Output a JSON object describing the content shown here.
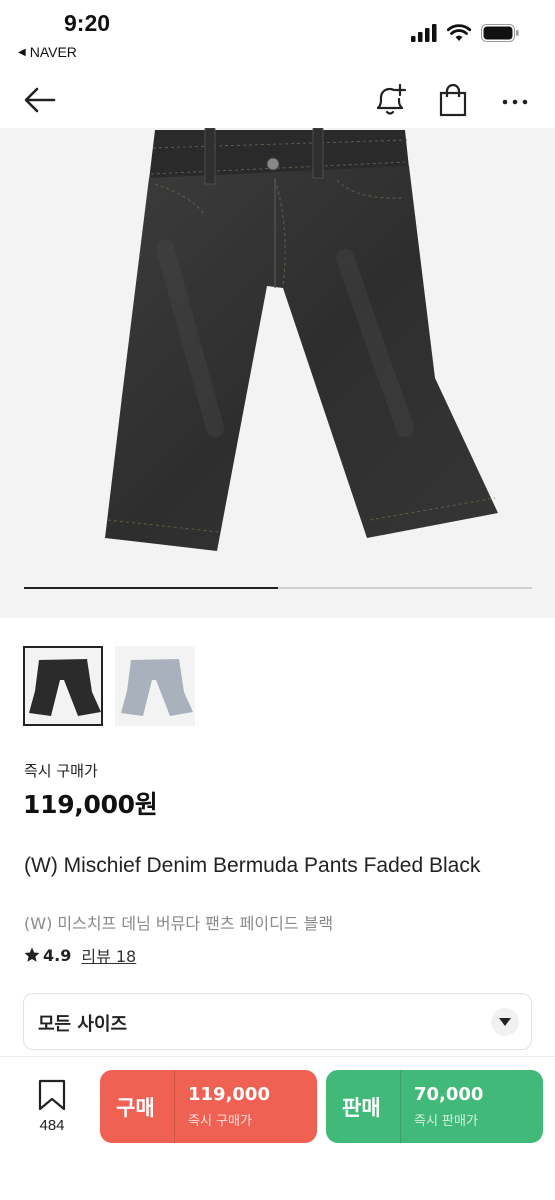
{
  "status_bar": {
    "time": "9:20",
    "back_app": "NAVER"
  },
  "product": {
    "price_label": "즉시 구매가",
    "price": "119,000원",
    "title_en": "(W) Mischief Denim Bermuda Pants Faded Black",
    "title_ko": "(W) 미스치프 데님 버뮤다 팬츠 페이디드 블랙",
    "rating": "4.9",
    "review_link": "리뷰 18",
    "image_progress": 0.5,
    "thumbnails": [
      {
        "name": "black-denim-shorts",
        "color": "#2b2b2b",
        "selected": true
      },
      {
        "name": "light-wash-denim-shorts",
        "color": "#a9b2bc",
        "selected": false
      }
    ]
  },
  "size_select": {
    "label": "모든 사이즈"
  },
  "bottom_bar": {
    "bookmark_count": "484",
    "buy": {
      "label": "구매",
      "price": "119,000",
      "sub": "즉시 구매가",
      "color": "#ef6253"
    },
    "sell": {
      "label": "판매",
      "price": "70,000",
      "sub": "즉시 판매가",
      "color": "#41b979"
    }
  },
  "icons": {
    "back": "arrow-left-icon",
    "alert": "bell-plus-icon",
    "bag": "shopping-bag-icon",
    "more": "ellipsis-icon",
    "bookmark": "bookmark-icon",
    "star": "star-icon",
    "chevron": "chevron-down-icon"
  }
}
